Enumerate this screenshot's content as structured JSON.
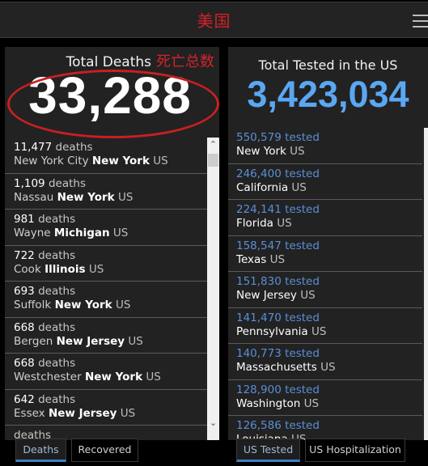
{
  "topbar": {
    "title": "美国",
    "menu_icon": "hamburger-menu-icon"
  },
  "deaths_panel": {
    "title_en": "Total Deaths",
    "title_cn": "死亡总数",
    "total": "33,288",
    "annotation": "red-ellipse-highlight",
    "unit": "deaths",
    "items": [
      {
        "count": "11,477",
        "county": "New York City",
        "state": "New York",
        "country": "US"
      },
      {
        "count": "1,109",
        "county": "Nassau",
        "state": "New York",
        "country": "US"
      },
      {
        "count": "981",
        "county": "Wayne",
        "state": "Michigan",
        "country": "US"
      },
      {
        "count": "722",
        "county": "Cook",
        "state": "Illinois",
        "country": "US"
      },
      {
        "count": "693",
        "county": "Suffolk",
        "state": "New York",
        "country": "US"
      },
      {
        "count": "668",
        "county": "Bergen",
        "state": "New Jersey",
        "country": "US"
      },
      {
        "count": "668",
        "county": "Westchester",
        "state": "New York",
        "country": "US"
      },
      {
        "count": "642",
        "county": "Essex",
        "state": "New Jersey",
        "country": "US"
      },
      {
        "count": "",
        "county": "",
        "state": "",
        "country": ""
      }
    ],
    "tabs": [
      {
        "label": "Deaths",
        "active": true
      },
      {
        "label": "Recovered",
        "active": false
      }
    ]
  },
  "tested_panel": {
    "title": "Total Tested in the US",
    "total": "3,423,034",
    "unit": "tested",
    "items": [
      {
        "count": "550,579",
        "state": "New York",
        "country": "US"
      },
      {
        "count": "246,400",
        "state": "California",
        "country": "US"
      },
      {
        "count": "224,141",
        "state": "Florida",
        "country": "US"
      },
      {
        "count": "158,547",
        "state": "Texas",
        "country": "US"
      },
      {
        "count": "151,830",
        "state": "New Jersey",
        "country": "US"
      },
      {
        "count": "141,470",
        "state": "Pennsylvania",
        "country": "US"
      },
      {
        "count": "140,773",
        "state": "Massachusetts",
        "country": "US"
      },
      {
        "count": "128,900",
        "state": "Washington",
        "country": "US"
      },
      {
        "count": "126,586",
        "state": "Louisiana",
        "country": "US"
      }
    ],
    "tabs": [
      {
        "label": "US Tested",
        "active": true
      },
      {
        "label": "US Hospitalization",
        "active": false
      }
    ]
  },
  "scroll_icons": {
    "up": "^",
    "down": "v"
  }
}
